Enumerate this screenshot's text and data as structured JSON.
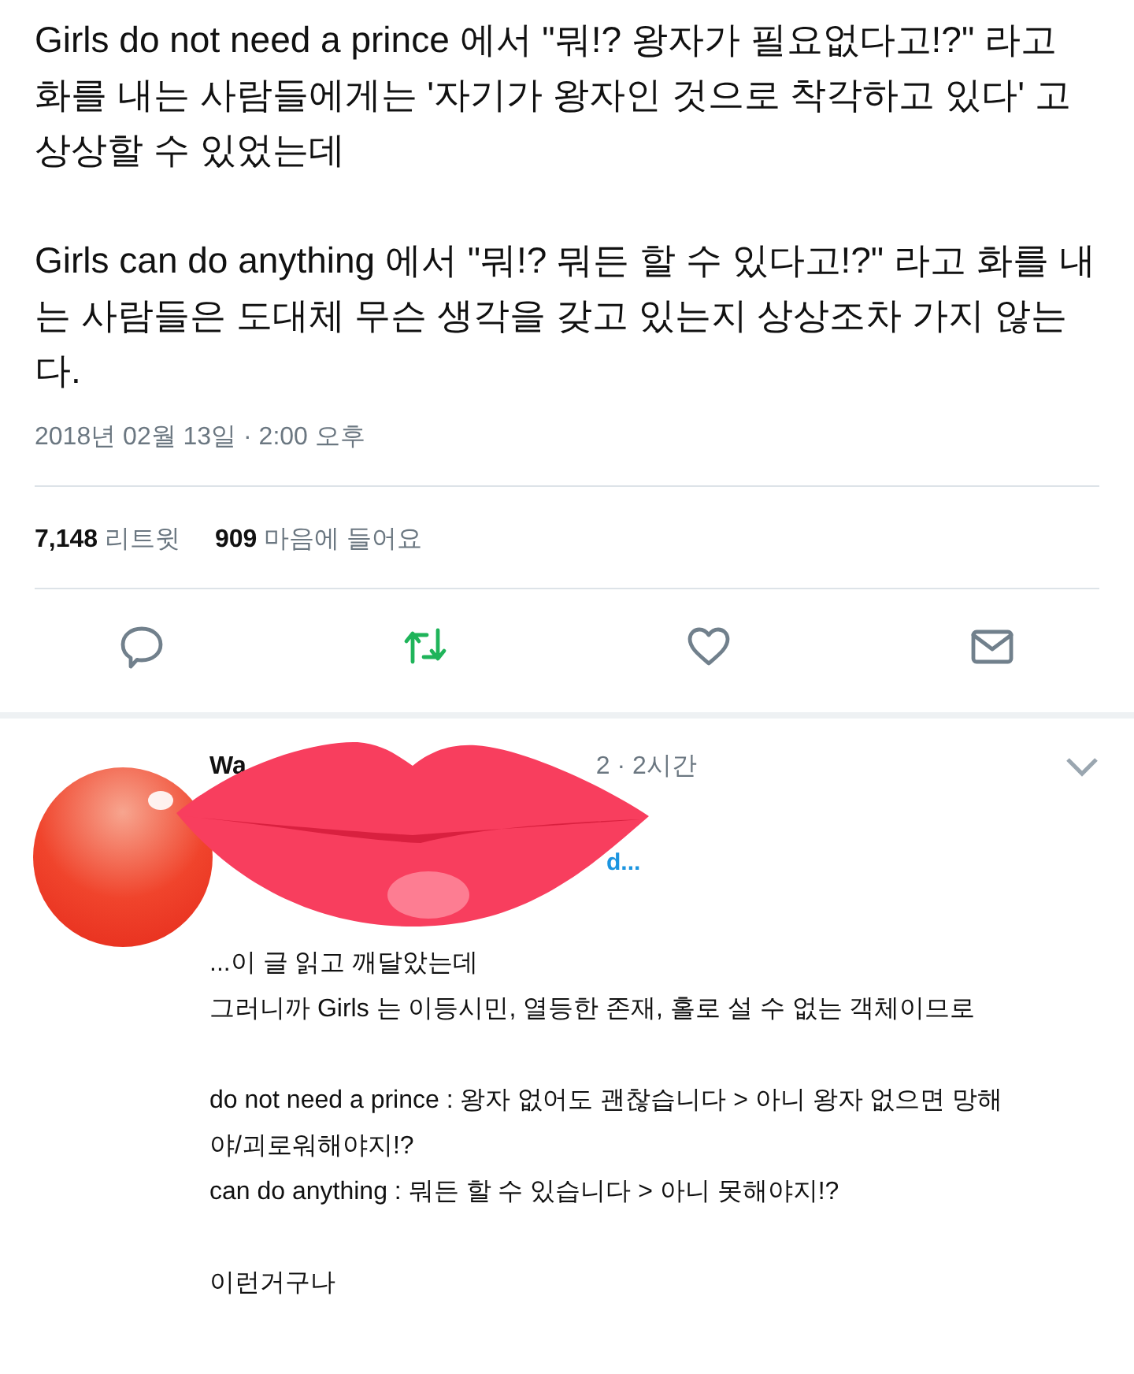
{
  "tweet": {
    "paragraphs": [
      "Girls do not need a prince 에서 \"뭐!? 왕자가 필요없다고!?\" 라고 화를 내는 사람들에게는 '자기가 왕자인 것으로 착각하고 있다' 고 상상할 수 있었는데",
      "Girls can do anything 에서 \"뭐!? 뭐든 할 수 있다고!?\" 라고 화를 내는 사람들은 도대체 무슨 생각을 갖고 있는지 상상조차 가지 않는다."
    ],
    "timestamp": "2018년 02월 13일 · 2:00 오후",
    "stats": [
      {
        "count": "7,148",
        "label": "리트윗"
      },
      {
        "count": "909",
        "label": "마음에 들어요"
      }
    ],
    "actions": [
      {
        "kind": "reply",
        "active": false
      },
      {
        "kind": "retweet",
        "active": true
      },
      {
        "kind": "like",
        "active": false
      },
      {
        "kind": "message",
        "active": false
      }
    ]
  },
  "reply": {
    "name": "Wa",
    "handle_time": "2 · 2시간",
    "link": "d...",
    "paragraphs": [
      "...이 글 읽고 깨달았는데\n그러니까 Girls 는 이등시민, 열등한 존재, 홀로 설 수 없는 객체이므로",
      "do not need a prince : 왕자 없어도 괜찮습니다 > 아니 왕자 없으면 망해야/괴로워해야지!?\ncan do anything : 뭐든 할 수 있습니다 > 아니 못해야지!?",
      "이런거구나"
    ]
  }
}
